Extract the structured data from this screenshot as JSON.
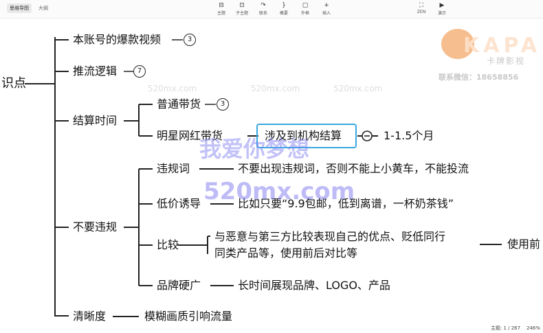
{
  "toolbar": {
    "tabs": [
      {
        "label": "思维导图",
        "active": true
      },
      {
        "label": "大纲",
        "active": false
      }
    ],
    "tools": [
      {
        "label": "主题",
        "icon": "⊟",
        "name": "topic"
      },
      {
        "label": "子主题",
        "icon": "⊡",
        "name": "subtopic"
      },
      {
        "label": "联系",
        "icon": "↷",
        "name": "relationship"
      },
      {
        "label": "概要",
        "icon": "}",
        "name": "summary"
      },
      {
        "label": "外框",
        "icon": "▢",
        "name": "boundary"
      },
      {
        "label": "插入",
        "icon": "+",
        "name": "insert"
      },
      {
        "label": "ZEN",
        "icon": "⛶",
        "name": "zen"
      },
      {
        "label": "演示",
        "icon": "▶",
        "name": "present"
      }
    ]
  },
  "mindmap": {
    "root": "识点",
    "b1": {
      "label": "本账号的爆款视频",
      "count": "3"
    },
    "b2": {
      "label": "推流逻辑",
      "count": "7"
    },
    "b3": {
      "label": "结算时间",
      "c1": {
        "label": "普通带货",
        "count": "3"
      },
      "c2": {
        "label": "明星网红带货",
        "sub": "涉及到机构结算",
        "leaf": "1-1.5个月"
      }
    },
    "b4": {
      "label": "不要违规",
      "c1": {
        "label": "违规词",
        "detail": "不要出现违规词，否则不能上小黄车，不能投流"
      },
      "c2": {
        "label": "低价诱导",
        "detail": "比如只要“9.9包邮，低到离谱，一杯奶茶钱”"
      },
      "c3": {
        "label": "比较",
        "detail1": "与恶意与第三方比较表现自己的优点、贬低同行",
        "detail2": "同类产品等，使用前后对比等",
        "tail": "使用前"
      },
      "c4": {
        "label": "品牌硬广",
        "detail": "长时间展现品牌、LOGO、产品"
      }
    },
    "b5": {
      "label": "清晰度",
      "detail": "模糊画质引响流量"
    }
  },
  "watermarks": {
    "site": "520mx.com",
    "slogan": "我爱你梦想",
    "big": "520mx.com"
  },
  "logo": {
    "brand": "KAPA",
    "name": "卡牌影视",
    "contact": "联系微信：18658856"
  },
  "status": {
    "topics": "主题: 1 / 267",
    "zoom": "246%"
  }
}
